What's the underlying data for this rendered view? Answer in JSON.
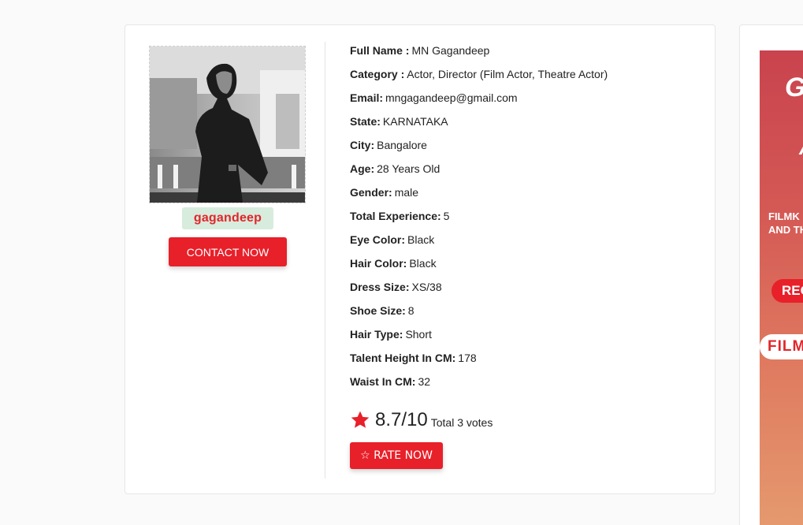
{
  "profile": {
    "username": "gagandeep",
    "contact_label": "CONTACT NOW",
    "photo_alt": "profile-photo",
    "details": [
      {
        "key": "Full Name :",
        "value": "MN Gagandeep"
      },
      {
        "key": "Category :",
        "value": "Actor, Director (Film Actor, Theatre Actor)"
      },
      {
        "key": "Email:",
        "value": "mngagandeep@gmail.com"
      },
      {
        "key": "State:",
        "value": "KARNATAKA"
      },
      {
        "key": "City:",
        "value": "Bangalore"
      },
      {
        "key": "Age:",
        "value": "28 Years Old"
      },
      {
        "key": "Gender:",
        "value": "male"
      },
      {
        "key": "Total Experience:",
        "value": "5"
      },
      {
        "key": "Eye Color:",
        "value": "Black"
      },
      {
        "key": "Hair Color:",
        "value": "Black"
      },
      {
        "key": "Dress Size:",
        "value": "XS/38"
      },
      {
        "key": "Shoe Size:",
        "value": "8"
      },
      {
        "key": "Hair Type:",
        "value": "Short"
      },
      {
        "key": "Talent Height In CM:",
        "value": "178"
      },
      {
        "key": "Waist In CM:",
        "value": "32"
      }
    ],
    "rating": {
      "icon": "star-icon",
      "score": "8.7/10",
      "votes": "Total 3 votes"
    },
    "rate_label": "☆ RATE NOW"
  },
  "ad": {
    "lines": [
      "G",
      "A",
      "FILMK",
      "AND TH",
      "REG",
      "FILM"
    ]
  },
  "colors": {
    "accent": "#e8202a",
    "badge_bg": "#d7ecdd",
    "badge_text": "#e2262b"
  }
}
